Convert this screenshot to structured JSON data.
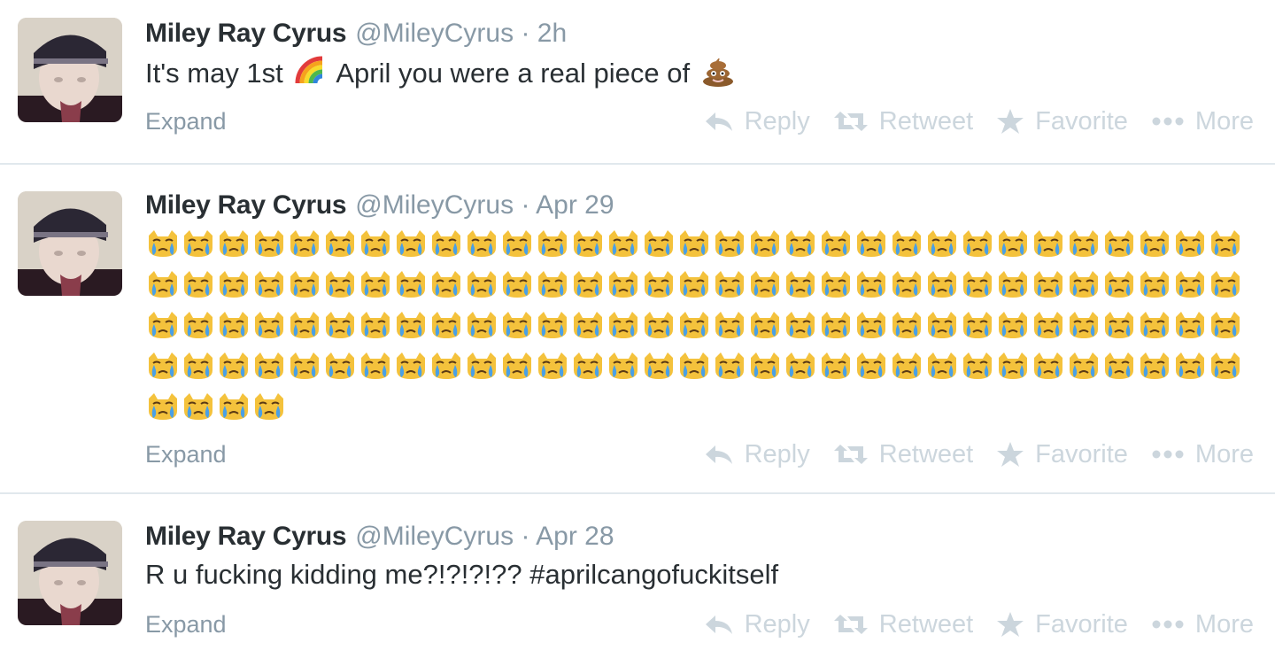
{
  "tweets": [
    {
      "name": "Miley Ray Cyrus",
      "handle": "@MileyCyrus",
      "dot": "·",
      "time": "2h",
      "text_before": "It's may 1st",
      "text_after": "April you were a real piece of",
      "expand": "Expand",
      "actions": {
        "reply": "Reply",
        "retweet": "Retweet",
        "favorite": "Favorite",
        "more": "More"
      }
    },
    {
      "name": "Miley Ray Cyrus",
      "handle": "@MileyCyrus",
      "dot": "·",
      "time": "Apr 29",
      "emoji_name": "crying-cat-face",
      "emoji_count": 128,
      "expand": "Expand",
      "actions": {
        "reply": "Reply",
        "retweet": "Retweet",
        "favorite": "Favorite",
        "more": "More"
      }
    },
    {
      "name": "Miley Ray Cyrus",
      "handle": "@MileyCyrus",
      "dot": "·",
      "time": "Apr 28",
      "text": "R u fucking kidding me?!?!?!?? ",
      "hashtag": "#aprilcangofuckitself",
      "expand": "Expand",
      "actions": {
        "reply": "Reply",
        "retweet": "Retweet",
        "favorite": "Favorite",
        "more": "More"
      }
    }
  ],
  "colors": {
    "meta_gray": "#8899a6",
    "action_gray": "#ccd6dd",
    "text": "#292f33",
    "divider": "#e1e8ed"
  }
}
